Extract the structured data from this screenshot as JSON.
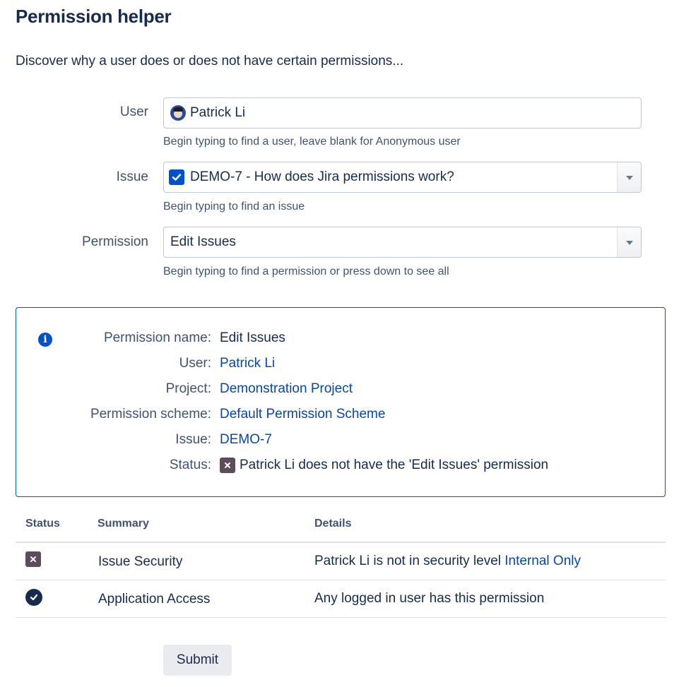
{
  "page": {
    "title": "Permission helper",
    "intro": "Discover why a user does or does not have certain permissions..."
  },
  "form": {
    "user": {
      "label": "User",
      "value": "Patrick Li",
      "help": "Begin typing to find a user, leave blank for Anonymous user"
    },
    "issue": {
      "label": "Issue",
      "value": "DEMO-7 - How does Jira permissions work?",
      "help": "Begin typing to find an issue"
    },
    "permission": {
      "label": "Permission",
      "value": "Edit Issues",
      "help": "Begin typing to find a permission or press down to see all"
    }
  },
  "info_panel": {
    "rows": [
      {
        "key": "Permission name:",
        "value": "Edit Issues"
      },
      {
        "key": "User:",
        "value": "Patrick Li"
      },
      {
        "key": "Project:",
        "value": "Demonstration Project"
      },
      {
        "key": "Permission scheme:",
        "value": "Default Permission Scheme"
      },
      {
        "key": "Issue:",
        "value": "DEMO-7"
      },
      {
        "key": "Status:",
        "value": "Patrick Li does not have the 'Edit Issues' permission"
      }
    ]
  },
  "results_table": {
    "headers": {
      "status": "Status",
      "summary": "Summary",
      "details": "Details"
    },
    "rows": [
      {
        "status": "denied",
        "summary": "Issue Security",
        "details": "Patrick Li is not in security level",
        "details_link": "Internal Only"
      },
      {
        "status": "granted",
        "summary": "Application Access",
        "details": "Any logged in user has this permission",
        "details_link": ""
      }
    ]
  },
  "actions": {
    "submit_label": "Submit"
  },
  "colors": {
    "accent": "#0052cc",
    "link": "#0747a6",
    "text": "#172b4d",
    "muted": "#42526e",
    "denied": "#5e4b5e",
    "granted": "#172b4d"
  }
}
